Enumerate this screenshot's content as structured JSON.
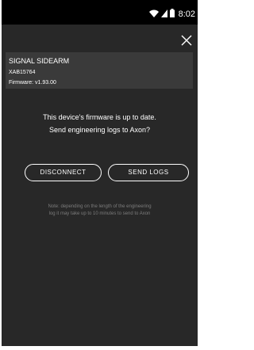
{
  "status_bar": {
    "time": "8:02",
    "icons": [
      "wifi-icon",
      "signal-icon",
      "battery-icon"
    ]
  },
  "device": {
    "name": "SIGNAL SIDEARM",
    "serial": "XAB15764",
    "firmware": "Firmware: v1.93.00"
  },
  "message": {
    "line1": "This device's firmware is up to date.",
    "line2": "Send engineering logs to Axon?"
  },
  "actions": {
    "disconnect_label": "DISCONNECT",
    "send_logs_label": "SEND LOGS"
  },
  "note": {
    "line1": "Note: depending on the length of the engineering",
    "line2": "log it may take up to 10 minutes to send to Axon"
  },
  "colors": {
    "background": "#282828",
    "card": "#3a3a3a",
    "status_bar": "#000000",
    "text": "#ffffff",
    "note_text": "#7c7c7c"
  }
}
